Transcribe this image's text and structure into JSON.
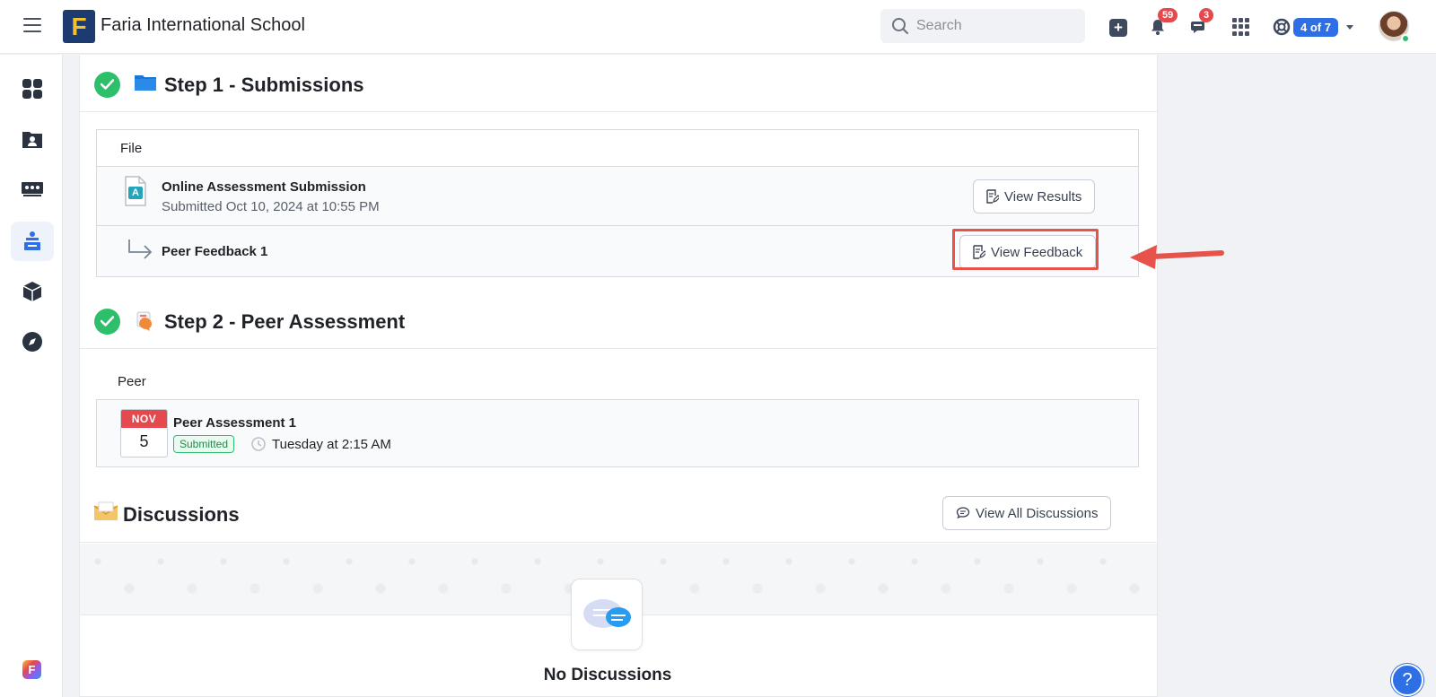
{
  "header": {
    "logo_letter": "F",
    "school_name": "Faria International School",
    "search_placeholder": "Search",
    "notifications_count": "59",
    "messages_count": "3",
    "account_switch": "4 of 7"
  },
  "sidebar": {
    "items": [
      {
        "icon": "dashboard-grid-icon"
      },
      {
        "icon": "student-folder-icon"
      },
      {
        "icon": "classes-icon"
      },
      {
        "icon": "assessment-icon",
        "active": true
      },
      {
        "icon": "cube-icon"
      },
      {
        "icon": "compass-icon"
      }
    ],
    "brand_letter": "F"
  },
  "step1": {
    "title": "Step 1 - Submissions",
    "section_label": "File",
    "submission": {
      "file_badge": "A",
      "title": "Online Assessment Submission",
      "subtitle": "Submitted Oct 10, 2024 at 10:55 PM",
      "button": "View Results"
    },
    "feedback": {
      "title": "Peer Feedback 1",
      "button": "View Feedback"
    }
  },
  "step2": {
    "title": "Step 2 - Peer Assessment",
    "section_label": "Peer",
    "assessment": {
      "month": "NOV",
      "day": "5",
      "title": "Peer Assessment 1",
      "status": "Submitted",
      "time": "Tuesday at 2:15 AM"
    }
  },
  "discussions": {
    "title": "Discussions",
    "button": "View All Discussions",
    "empty_title": "No Discussions"
  },
  "help": {
    "label": "?"
  },
  "colors": {
    "accent": "#2f6fe5",
    "success": "#2ebf6b",
    "danger": "#e5484d",
    "highlight": "#e5534b"
  }
}
